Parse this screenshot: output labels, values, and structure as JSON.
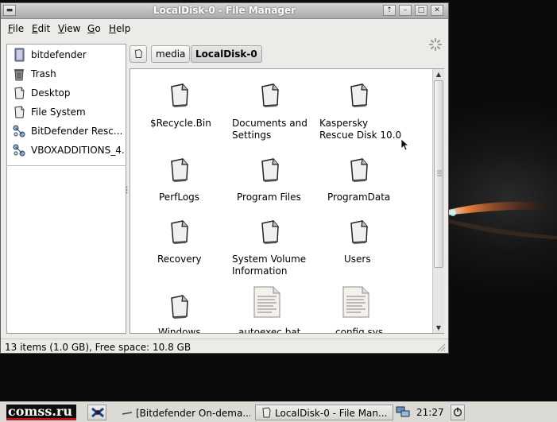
{
  "window": {
    "title": "LocalDisk-0 - File Manager"
  },
  "menu": [
    {
      "label": "File",
      "accel": "F",
      "rest": "ile"
    },
    {
      "label": "Edit",
      "accel": "E",
      "rest": "dit"
    },
    {
      "label": "View",
      "accel": "V",
      "rest": "iew"
    },
    {
      "label": "Go",
      "accel": "G",
      "rest": "o"
    },
    {
      "label": "Help",
      "accel": "H",
      "rest": "elp"
    }
  ],
  "sidebar": {
    "items": [
      {
        "label": "bitdefender",
        "icon": "user-home-icon"
      },
      {
        "label": "Trash",
        "icon": "trash-icon"
      },
      {
        "label": "Desktop",
        "icon": "desktop-icon"
      },
      {
        "label": "File System",
        "icon": "drive-icon"
      },
      {
        "label": "BitDefender Resc...",
        "icon": "network-drive-icon"
      },
      {
        "label": "VBOXADDITIONS_4.",
        "icon": "network-drive-icon"
      }
    ]
  },
  "pathbar": {
    "crumbs": [
      "media",
      "LocalDisk-0"
    ]
  },
  "files": [
    {
      "line1": "$Recycle.Bin",
      "line2": "",
      "type": "folder"
    },
    {
      "line1": "Documents and",
      "line2": "Settings",
      "type": "folder"
    },
    {
      "line1": "Kaspersky",
      "line2": "Rescue Disk 10.0",
      "type": "folder"
    },
    {
      "line1": "PerfLogs",
      "line2": "",
      "type": "folder"
    },
    {
      "line1": "Program Files",
      "line2": "",
      "type": "folder"
    },
    {
      "line1": "ProgramData",
      "line2": "",
      "type": "folder"
    },
    {
      "line1": "Recovery",
      "line2": "",
      "type": "folder"
    },
    {
      "line1": "System Volume",
      "line2": "Information",
      "type": "folder"
    },
    {
      "line1": "Users",
      "line2": "",
      "type": "folder"
    },
    {
      "line1": "Windows",
      "line2": "",
      "type": "folder"
    },
    {
      "line1": "autoexec.bat",
      "line2": "",
      "type": "text-file"
    },
    {
      "line1": "config.sys",
      "line2": "",
      "type": "text-file"
    }
  ],
  "status": {
    "text": "13 items (1.0 GB), Free space: 10.8 GB"
  },
  "taskbar": {
    "logo_text": "comss.ru",
    "tasks": [
      {
        "label": "[Bitdefender On-dema..."
      },
      {
        "label": "LocalDisk-0 - File Man..."
      }
    ],
    "clock": "21:27"
  },
  "colors": {
    "logo_red": "#c0161b",
    "titlebar": "#b8b8b8"
  }
}
